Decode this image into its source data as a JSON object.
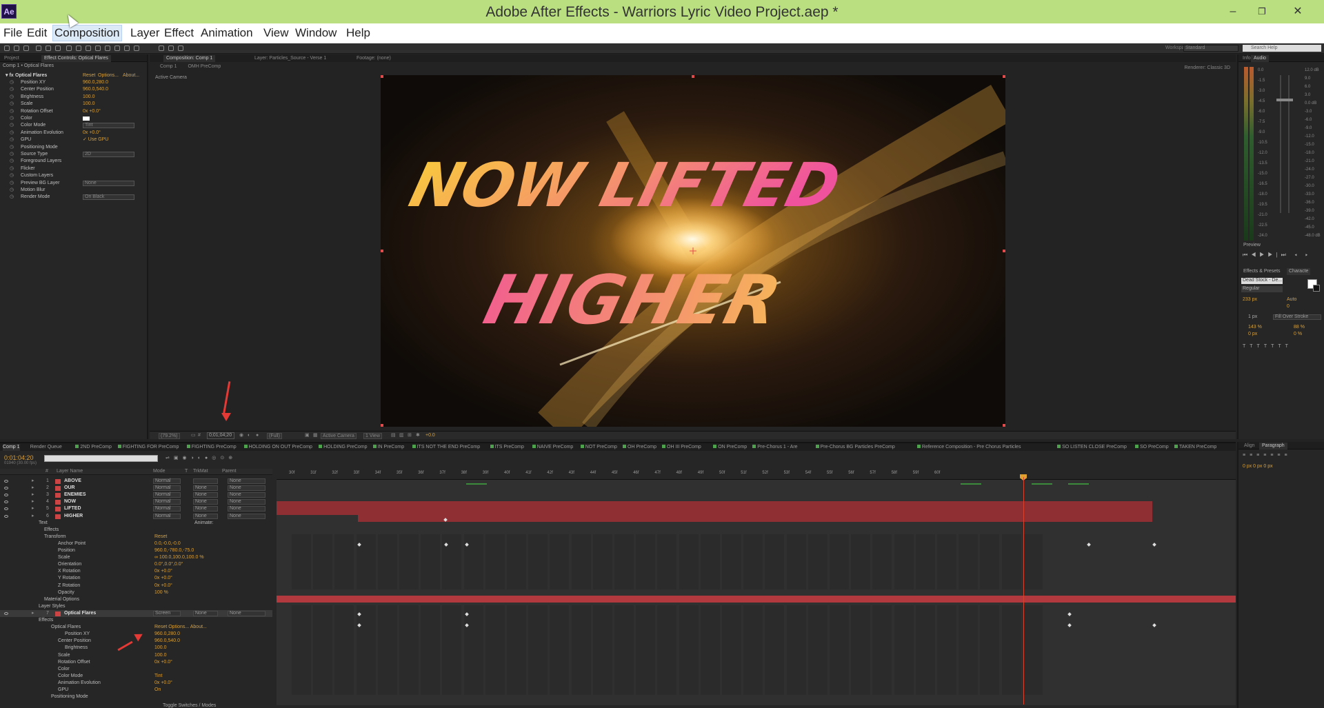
{
  "window": {
    "app_icon": "Ae",
    "title": "Adobe After Effects - Warriors Lyric Video Project.aep *",
    "minimize": "–",
    "restore": "❐",
    "close": "✕"
  },
  "menu": [
    "File",
    "Edit",
    "Composition",
    "Layer",
    "Effect",
    "Animation",
    "View",
    "Window",
    "Help"
  ],
  "menu_selected": "Composition",
  "toolbar": {
    "workspace_label": "Workspace:",
    "workspace_value": "Standard",
    "search_placeholder": "Search Help"
  },
  "effect_controls": {
    "tabs": [
      "Project",
      "Effect Controls: Optical Flares"
    ],
    "breadcrumb": "Comp 1 • Optical Flares",
    "effect_name": "Optical Flares",
    "effect_links": [
      "Reset",
      "Options...",
      "About..."
    ],
    "rows": [
      {
        "label": "Position XY",
        "value": "960.0,280.0"
      },
      {
        "label": "Center Position",
        "value": "960.0,540.0"
      },
      {
        "label": "Brightness",
        "value": "100.0"
      },
      {
        "label": "Scale",
        "value": "100.0"
      },
      {
        "label": "Rotation Offset",
        "value": "0x +0.0°"
      },
      {
        "label": "Color",
        "value": ""
      },
      {
        "label": "Color Mode",
        "value": "Tint"
      },
      {
        "label": "Animation Evolution",
        "value": "0x +0.0°"
      },
      {
        "label": "GPU",
        "value": "✓ Use GPU"
      },
      {
        "label": "Positioning Mode",
        "value": ""
      },
      {
        "label": "Source Type",
        "value": "2D"
      },
      {
        "label": "Foreground Layers",
        "value": ""
      },
      {
        "label": "Flicker",
        "value": ""
      },
      {
        "label": "Custom Layers",
        "value": ""
      },
      {
        "label": "Preview BG Layer",
        "value": "None"
      },
      {
        "label": "Motion Blur",
        "value": ""
      },
      {
        "label": "Render Mode",
        "value": "On Black"
      }
    ]
  },
  "viewer": {
    "tabs": [
      "Composition: Comp 1",
      "Layer: Particles_Source - Verse 1",
      "Footage: (none)"
    ],
    "sub_tabs": [
      "Comp 1",
      "OMH PreComp"
    ],
    "active_camera": "Active Camera",
    "renderer": "Renderer: Classic 3D",
    "lyric_line1": "NOW LIFTED",
    "lyric_line2": "HIGHER",
    "zoom": "(79.2%)",
    "timecode": "0;01;04;20",
    "resolution": "(Full)",
    "camera": "Active Camera",
    "views": "1 View",
    "exposure": "+0.0"
  },
  "right_panels": {
    "info_tabs": [
      "Info",
      "Audio"
    ],
    "audio_levels": [
      "0.0",
      "-1.5",
      "-3.0",
      "-4.5",
      "-6.0",
      "-7.5",
      "-9.0",
      "-10.5",
      "-12.0",
      "-13.5",
      "-15.0",
      "-16.5",
      "-18.0",
      "-19.5",
      "-21.0",
      "-22.5",
      "-24.0"
    ],
    "db_scale": [
      "12.0 dB",
      "9.0",
      "6.0",
      "3.0",
      "0.0 dB",
      "-3.0",
      "-6.0",
      "-9.0",
      "-12.0",
      "-15.0",
      "-18.0",
      "-21.0",
      "-24.0",
      "-27.0",
      "-30.0",
      "-33.0",
      "-36.0",
      "-39.0",
      "-42.0",
      "-45.0",
      "-48.0 dB"
    ],
    "preview_tab": "Preview",
    "effects_tab": "Effects & Presets",
    "character_tab": "Characte",
    "font": "Dead Stock - De...",
    "style": "Regular",
    "font_size": "233 px",
    "leading": "Auto",
    "tracking": "0",
    "stroke": "1 px",
    "stroke_mode": "Fill Over Stroke",
    "vscale": "143 %",
    "hscale": "88 %",
    "baseline": "0 px",
    "tsume": "0 %",
    "align_tab": "Align",
    "paragraph_tab": "Paragraph"
  },
  "timeline": {
    "tabs": [
      "Comp 1",
      "Render Queue",
      "2ND PreComp",
      "FIGHTING FOR PreComp",
      "FIGHTING PreComp",
      "HOLDING ON OUT PreComp",
      "HOLDING PreComp",
      "IN PreComp",
      "ITS NOT THE END PreComp",
      "ITS PreComp",
      "NAIVE PreComp",
      "NOT PreComp",
      "OH PreComp",
      "OH III PreComp",
      "ON PreComp",
      "Pre-Chorus 1 - Are",
      "Pre-Chorus BG Particles PreComp",
      "Reference Composition - Pre Chorus Particles",
      "SO LISTEN CLOSE PreComp",
      "SO PreComp",
      "TAKEN PreComp"
    ],
    "timecode": "0:01:04:20",
    "fps": "01940 (30.00 fps)",
    "columns": [
      "#",
      "Layer Name",
      "Mode",
      "T",
      "TrkMat",
      "Parent"
    ],
    "ruler": [
      "30f",
      "31f",
      "32f",
      "33f",
      "34f",
      "35f",
      "36f",
      "37f",
      "38f",
      "39f",
      "40f",
      "41f",
      "42f",
      "43f",
      "44f",
      "45f",
      "46f",
      "47f",
      "48f",
      "49f",
      "50f",
      "51f",
      "52f",
      "53f",
      "54f",
      "55f",
      "56f",
      "57f",
      "58f",
      "59f",
      "60f"
    ],
    "layers": [
      {
        "num": "1",
        "name": "ABOVE",
        "mode": "Normal",
        "trk": "",
        "parent": "None"
      },
      {
        "num": "2",
        "name": "OUR",
        "mode": "Normal",
        "trk": "None",
        "parent": "None"
      },
      {
        "num": "3",
        "name": "ENEMIES",
        "mode": "Normal",
        "trk": "None",
        "parent": "None"
      },
      {
        "num": "4",
        "name": "NOW",
        "mode": "Normal",
        "trk": "None",
        "parent": "None"
      },
      {
        "num": "5",
        "name": "LIFTED",
        "mode": "Normal",
        "trk": "None",
        "parent": "None"
      },
      {
        "num": "6",
        "name": "HIGHER",
        "mode": "Normal",
        "trk": "None",
        "parent": "None"
      }
    ],
    "higher_props": [
      {
        "indent": 56,
        "name": "Text",
        "value": ""
      },
      {
        "indent": 64,
        "name": "Effects",
        "value": ""
      },
      {
        "indent": 64,
        "name": "Transform",
        "value": "Reset"
      },
      {
        "indent": 84,
        "name": "Anchor Point",
        "value": "0.0,-0.0,-0.0"
      },
      {
        "indent": 84,
        "name": "Position",
        "value": "960.0,-780.0,-75.0"
      },
      {
        "indent": 84,
        "name": "Scale",
        "value": "∞ 100.0,100.0,100.0 %"
      },
      {
        "indent": 84,
        "name": "Orientation",
        "value": "0.0°,0.0°,0.0°"
      },
      {
        "indent": 84,
        "name": "X Rotation",
        "value": "0x +0.0°"
      },
      {
        "indent": 84,
        "name": "Y Rotation",
        "value": "0x +0.0°"
      },
      {
        "indent": 84,
        "name": "Z Rotation",
        "value": "0x +0.0°"
      },
      {
        "indent": 84,
        "name": "Opacity",
        "value": "100 %"
      },
      {
        "indent": 64,
        "name": "Material Options",
        "value": ""
      },
      {
        "indent": 56,
        "name": "Layer Styles",
        "value": ""
      }
    ],
    "animate_label": "Animate:",
    "flare_layer": {
      "num": "7",
      "name": "Optical Flares",
      "mode": "Screen",
      "trk": "None",
      "parent": "None"
    },
    "flare_props": [
      {
        "indent": 56,
        "name": "Effects",
        "value": ""
      },
      {
        "indent": 74,
        "name": "Optical Flares",
        "value": "Reset    Options...    About..."
      },
      {
        "indent": 94,
        "name": "Position XY",
        "value": "960.0,280.0"
      },
      {
        "indent": 84,
        "name": "Center Position",
        "value": "960.0,540.0"
      },
      {
        "indent": 94,
        "name": "Brightness",
        "value": "100.0"
      },
      {
        "indent": 84,
        "name": "Scale",
        "value": "100.0"
      },
      {
        "indent": 84,
        "name": "Rotation Offset",
        "value": "0x +0.0°"
      },
      {
        "indent": 84,
        "name": "Color",
        "value": ""
      },
      {
        "indent": 84,
        "name": "Color Mode",
        "value": "Tint"
      },
      {
        "indent": 84,
        "name": "Animation Evolution",
        "value": "0x +0.0°"
      },
      {
        "indent": 84,
        "name": "GPU",
        "value": "On"
      },
      {
        "indent": 74,
        "name": "Positioning Mode",
        "value": ""
      }
    ],
    "toggle_label": "Toggle Switches / Modes"
  },
  "colors": {
    "title_bar": "#b9df81",
    "accent_value": "#d8a03a",
    "layer_bar": "#8f2f33",
    "playhead": "#d8422f"
  }
}
